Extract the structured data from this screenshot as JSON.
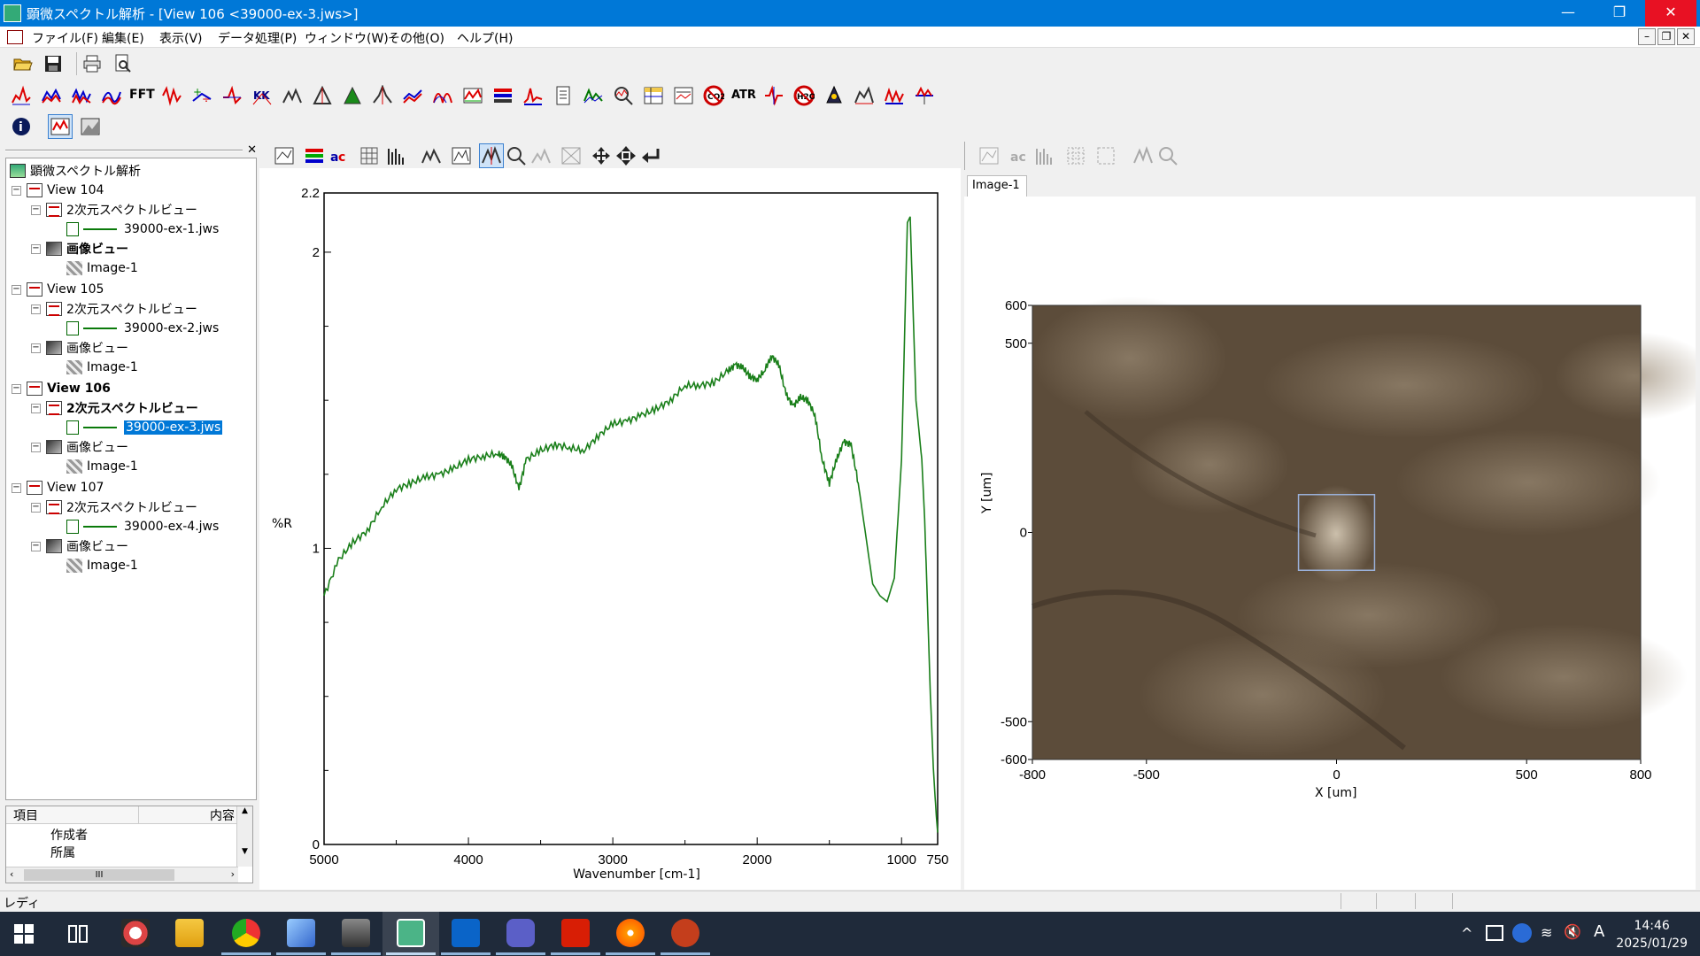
{
  "window": {
    "title": "顕微スペクトル解析 - [View 106 <39000-ex-3.jws>]",
    "minimize": "—",
    "maximize": "❐",
    "close": "✕"
  },
  "menu": [
    "ファイル(F)",
    "編集(E)",
    "表示(V)",
    "データ処理(P)",
    "ウィンドウ(W)",
    "その他(O)",
    "ヘルプ(H)"
  ],
  "toolbar_text": {
    "fft": "FFT",
    "atr": "ATR",
    "kk": "KK",
    "baseline": "Baseline",
    "co2": "CO2",
    "h2o": "H2O"
  },
  "tree": {
    "root": "顕微スペクトル解析",
    "views": [
      {
        "name": "View 104",
        "spec": "2次元スペクトルビュー",
        "file": "39000-ex-1.jws",
        "imgview": "画像ビュー",
        "image": "Image-1"
      },
      {
        "name": "View 105",
        "spec": "2次元スペクトルビュー",
        "file": "39000-ex-2.jws",
        "imgview": "画像ビュー",
        "image": "Image-1"
      },
      {
        "name": "View 106",
        "spec": "2次元スペクトルビュー",
        "file": "39000-ex-3.jws",
        "imgview": "画像ビュー",
        "image": "Image-1"
      },
      {
        "name": "View 107",
        "spec": "2次元スペクトルビュー",
        "file": "39000-ex-4.jws",
        "imgview": "画像ビュー",
        "image": "Image-1"
      }
    ]
  },
  "props": {
    "col_item": "項目",
    "col_content": "内容",
    "rows": [
      "作成者",
      "所属"
    ],
    "scroll_thumb": "III"
  },
  "spectrum_chart": {
    "type": "line",
    "xlabel": "Wavenumber [cm-1]",
    "ylabel": "%R",
    "xlim": [
      5000,
      750
    ],
    "ylim": [
      0,
      2.2
    ],
    "xticks": [
      "5000",
      "4000",
      "3000",
      "2000",
      "1000",
      "750"
    ],
    "yticks": [
      "0",
      "1",
      "2",
      "2.2"
    ],
    "line_color": "#1a7f1a",
    "x": [
      5000,
      4900,
      4800,
      4700,
      4600,
      4500,
      4400,
      4300,
      4200,
      4100,
      4000,
      3900,
      3800,
      3750,
      3700,
      3650,
      3600,
      3500,
      3400,
      3300,
      3200,
      3100,
      3000,
      2900,
      2800,
      2700,
      2600,
      2500,
      2400,
      2300,
      2200,
      2150,
      2100,
      2050,
      2000,
      1950,
      1900,
      1850,
      1800,
      1750,
      1700,
      1650,
      1600,
      1550,
      1500,
      1450,
      1400,
      1350,
      1300,
      1250,
      1200,
      1150,
      1100,
      1050,
      1000,
      980,
      960,
      940,
      920,
      900,
      880,
      860,
      840,
      820,
      800,
      780,
      760,
      750
    ],
    "y": [
      0.84,
      0.96,
      1.02,
      1.06,
      1.14,
      1.2,
      1.22,
      1.24,
      1.25,
      1.27,
      1.3,
      1.31,
      1.32,
      1.31,
      1.28,
      1.2,
      1.3,
      1.33,
      1.35,
      1.34,
      1.33,
      1.38,
      1.42,
      1.43,
      1.45,
      1.47,
      1.5,
      1.55,
      1.55,
      1.56,
      1.6,
      1.62,
      1.61,
      1.58,
      1.57,
      1.6,
      1.65,
      1.62,
      1.52,
      1.48,
      1.51,
      1.5,
      1.45,
      1.3,
      1.22,
      1.3,
      1.36,
      1.35,
      1.22,
      1.05,
      0.88,
      0.84,
      0.82,
      0.9,
      1.3,
      1.7,
      2.1,
      2.12,
      1.8,
      1.5,
      1.4,
      1.3,
      1.1,
      0.8,
      0.5,
      0.26,
      0.1,
      0.04
    ]
  },
  "image_view": {
    "tab": "Image-1",
    "xlabel": "X [um]",
    "ylabel": "Y [um]",
    "xticks": [
      "-800",
      "-500",
      "0",
      "500",
      "800"
    ],
    "yticks": [
      "600",
      "500",
      "0",
      "-500",
      "-600"
    ],
    "xlim": [
      -800,
      800
    ],
    "ylim": [
      -600,
      600
    ],
    "roi": {
      "x_range": [
        -100,
        100
      ],
      "y_range": [
        -100,
        100
      ]
    }
  },
  "status": "レディ",
  "clock": {
    "time": "14:46",
    "date": "2025/01/29"
  },
  "tray": {
    "ime": "A"
  }
}
